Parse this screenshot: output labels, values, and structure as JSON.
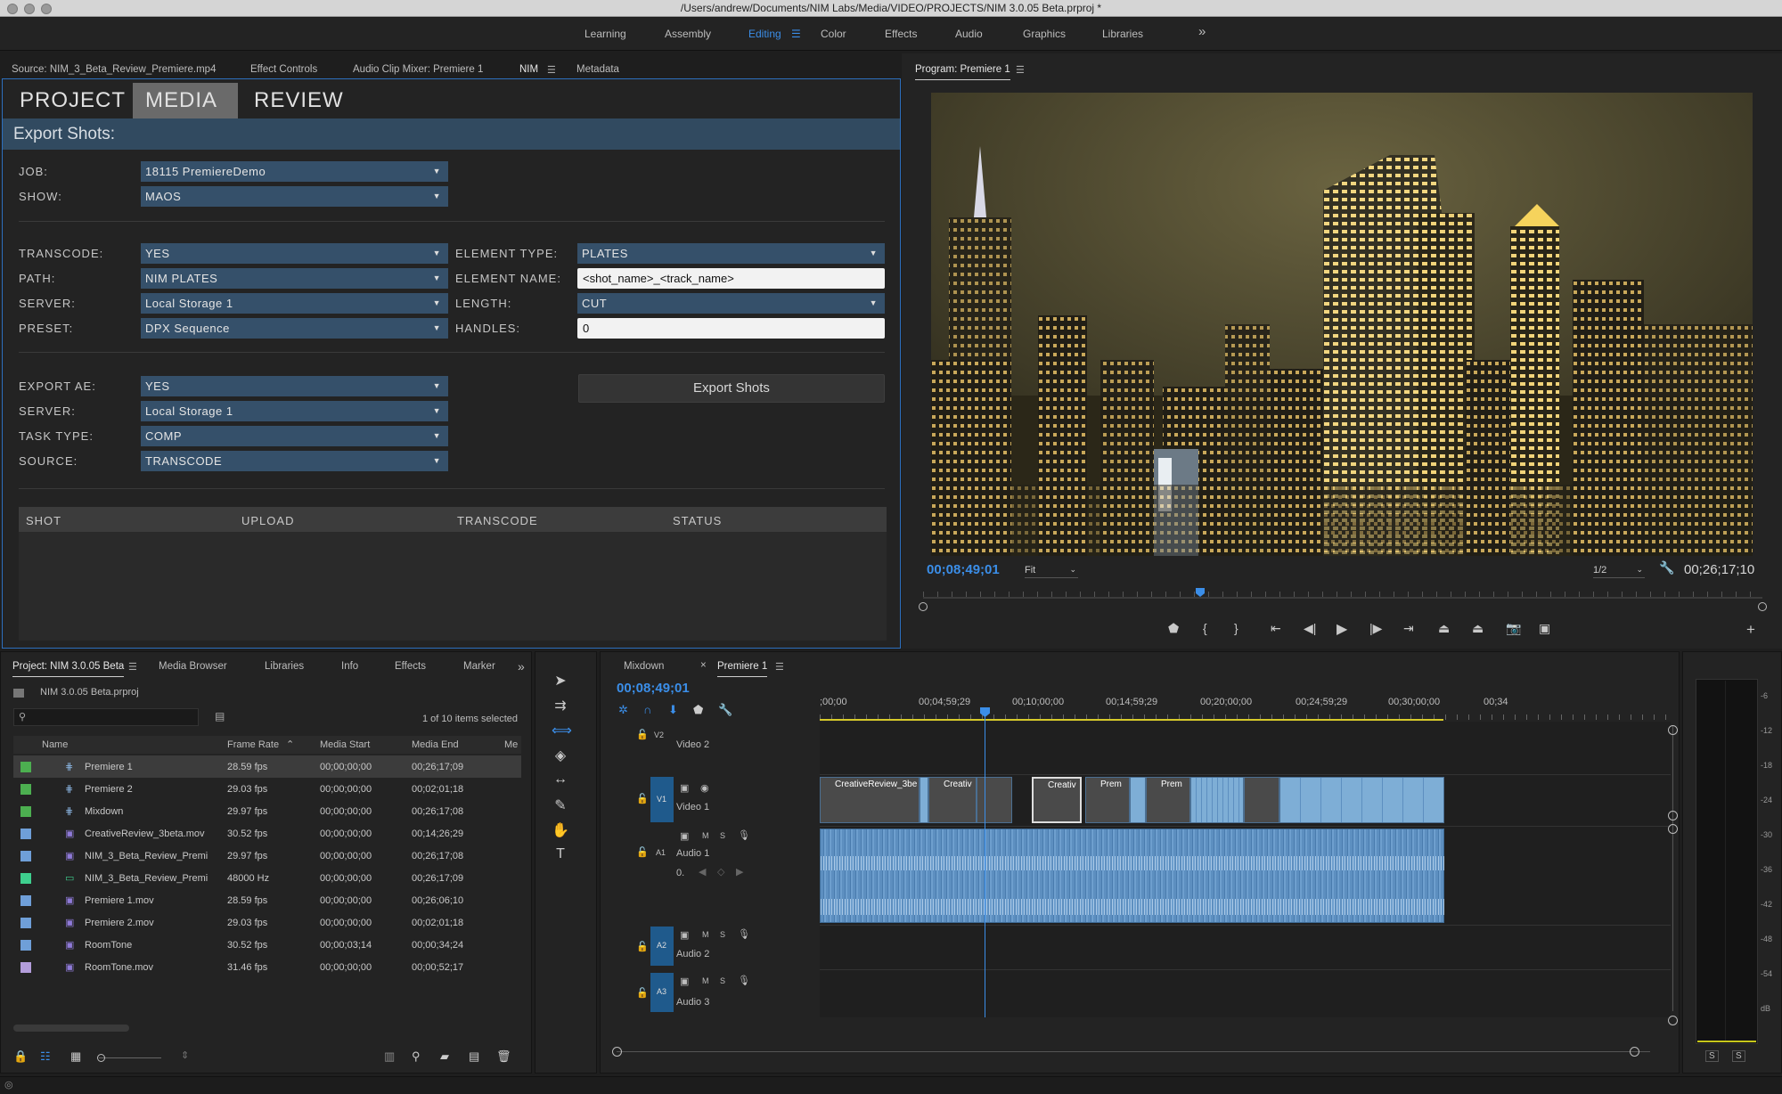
{
  "window": {
    "title": "/Users/andrew/Documents/NIM Labs/Media/VIDEO/PROJECTS/NIM 3.0.05 Beta.prproj *"
  },
  "workspaces": {
    "items": [
      "Learning",
      "Assembly",
      "Editing",
      "Color",
      "Effects",
      "Audio",
      "Graphics",
      "Libraries"
    ],
    "active": "Editing",
    "overflow": "»"
  },
  "source_panel": {
    "tabs": [
      "Source: NIM_3_Beta_Review_Premiere.mp4",
      "Effect Controls",
      "Audio Clip Mixer: Premiere 1",
      "NIM",
      "Metadata"
    ],
    "nim": {
      "nav": {
        "project": "PROJECT",
        "media": "MEDIA",
        "review": "REVIEW"
      },
      "section_title": "Export Shots:",
      "job_label": "JOB:",
      "job_value": "18115 PremiereDemo",
      "show_label": "SHOW:",
      "show_value": "MAOS",
      "transcode_label": "TRANSCODE:",
      "transcode_value": "YES",
      "path_label": "PATH:",
      "path_value": "NIM PLATES",
      "server_label": "SERVER:",
      "server_value": "Local Storage 1",
      "preset_label": "PRESET:",
      "preset_value": "DPX Sequence",
      "element_type_label": "ELEMENT TYPE:",
      "element_type_value": "PLATES",
      "element_name_label": "ELEMENT NAME:",
      "element_name_value": "<shot_name>_<track_name>",
      "length_label": "LENGTH:",
      "length_value": "CUT",
      "handles_label": "HANDLES:",
      "handles_value": "0",
      "export_ae_label": "EXPORT AE:",
      "export_ae_value": "YES",
      "server2_label": "SERVER:",
      "server2_value": "Local Storage 1",
      "task_type_label": "TASK TYPE:",
      "task_type_value": "COMP",
      "source_label": "SOURCE:",
      "source_value": "TRANSCODE",
      "export_button": "Export Shots",
      "table_headers": [
        "SHOT",
        "UPLOAD",
        "TRANSCODE",
        "STATUS"
      ]
    }
  },
  "program_monitor": {
    "title": "Program: Premiere 1",
    "current_tc": "00;08;49;01",
    "fit": "Fit",
    "resolution": "1/2",
    "duration_tc": "00;26;17;10"
  },
  "project_panel": {
    "tabs": [
      "Project: NIM 3.0.05 Beta",
      "Media Browser",
      "Libraries",
      "Info",
      "Effects",
      "Marker"
    ],
    "project_file": "NIM 3.0.05 Beta.prproj",
    "selection_info": "1 of 10 items selected",
    "columns": [
      "Name",
      "Frame Rate",
      "Media Start",
      "Media End",
      "Me"
    ],
    "rows": [
      {
        "name": "Premiere 1",
        "rate": "28.59 fps",
        "start": "00;00;00;00",
        "end": "00;26;17;09",
        "color": "#4caf50",
        "icon": "sequence-icon"
      },
      {
        "name": "Premiere 2",
        "rate": "29.03 fps",
        "start": "00;00;00;00",
        "end": "00;02;01;18",
        "color": "#4caf50",
        "icon": "sequence-icon"
      },
      {
        "name": "Mixdown",
        "rate": "29.97 fps",
        "start": "00;00;00;00",
        "end": "00;26;17;08",
        "color": "#4caf50",
        "icon": "sequence-icon"
      },
      {
        "name": "CreativeReview_3beta.mov",
        "rate": "30.52 fps",
        "start": "00;00;00;00",
        "end": "00;14;26;29",
        "color": "#6f9fd8",
        "icon": "clip-icon"
      },
      {
        "name": "NIM_3_Beta_Review_Premi",
        "rate": "29.97 fps",
        "start": "00;00;00;00",
        "end": "00;26;17;08",
        "color": "#6f9fd8",
        "icon": "clip-icon"
      },
      {
        "name": "NIM_3_Beta_Review_Premi",
        "rate": "48000 Hz",
        "start": "00;00;00;00",
        "end": "00;26;17;09",
        "color": "#3ecf8e",
        "icon": "audio-clip-icon"
      },
      {
        "name": "Premiere 1.mov",
        "rate": "28.59 fps",
        "start": "00;00;00;00",
        "end": "00;26;06;10",
        "color": "#6f9fd8",
        "icon": "clip-icon"
      },
      {
        "name": "Premiere 2.mov",
        "rate": "29.03 fps",
        "start": "00;00;00;00",
        "end": "00;02;01;18",
        "color": "#6f9fd8",
        "icon": "clip-icon"
      },
      {
        "name": "RoomTone",
        "rate": "30.52 fps",
        "start": "00;00;03;14",
        "end": "00;00;34;24",
        "color": "#6f9fd8",
        "icon": "clip-icon"
      },
      {
        "name": "RoomTone.mov",
        "rate": "31.46 fps",
        "start": "00;00;00;00",
        "end": "00;00;52;17",
        "color": "#b39ddb",
        "icon": "clip-icon"
      }
    ]
  },
  "timeline": {
    "tabs": [
      "Mixdown",
      "Premiere 1"
    ],
    "current_tc": "00;08;49;01",
    "ruler": [
      ";00;00",
      "00;04;59;29",
      "00;10;00;00",
      "00;14;59;29",
      "00;20;00;00",
      "00;24;59;29",
      "00;30;00;00",
      "00;34"
    ],
    "tracks": {
      "v2": {
        "id": "V2",
        "name": "Video 2"
      },
      "v1": {
        "id": "V1",
        "name": "Video 1"
      },
      "a1": {
        "id": "A1",
        "name": "Audio 1",
        "level": "0."
      },
      "a2": {
        "id": "A2",
        "name": "Audio 2"
      },
      "a3": {
        "id": "A3",
        "name": "Audio 3"
      }
    },
    "toggle_m": "M",
    "toggle_s": "S",
    "clip_labels": [
      "CreativeReview_3be",
      "Creativ",
      "Creativ",
      "Prem",
      "Prem"
    ]
  },
  "audio_meter": {
    "scale": [
      "-6",
      "-12",
      "-18",
      "-24",
      "-30",
      "-36",
      "-42",
      "-48",
      "-54",
      "dB"
    ],
    "solo": "S"
  }
}
